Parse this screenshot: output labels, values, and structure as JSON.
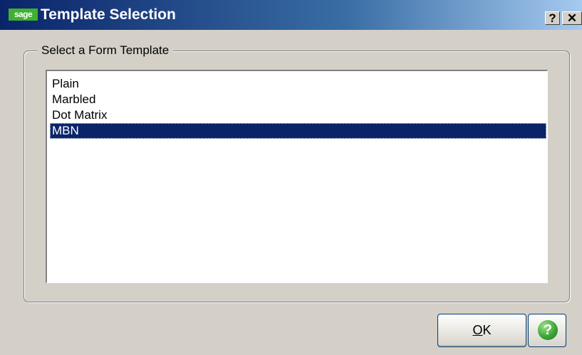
{
  "window": {
    "title": "Template Selection",
    "logo_text": "sage",
    "help_glyph": "?",
    "close_glyph": "✕"
  },
  "group": {
    "label": "Select a Form Template"
  },
  "templates": {
    "items": [
      "Plain",
      "Marbled",
      "Dot Matrix",
      "MBN"
    ],
    "selected_index": 3
  },
  "buttons": {
    "ok_mnemonic": "O",
    "ok_rest": "K",
    "help_glyph": "?"
  },
  "icons": {
    "help": "help-icon",
    "close": "close-icon"
  },
  "colors": {
    "title_gradient_start": "#0a246a",
    "selection": "#0a246a",
    "help_green": "#3da53a",
    "dialog_face": "#d4d0c8"
  }
}
